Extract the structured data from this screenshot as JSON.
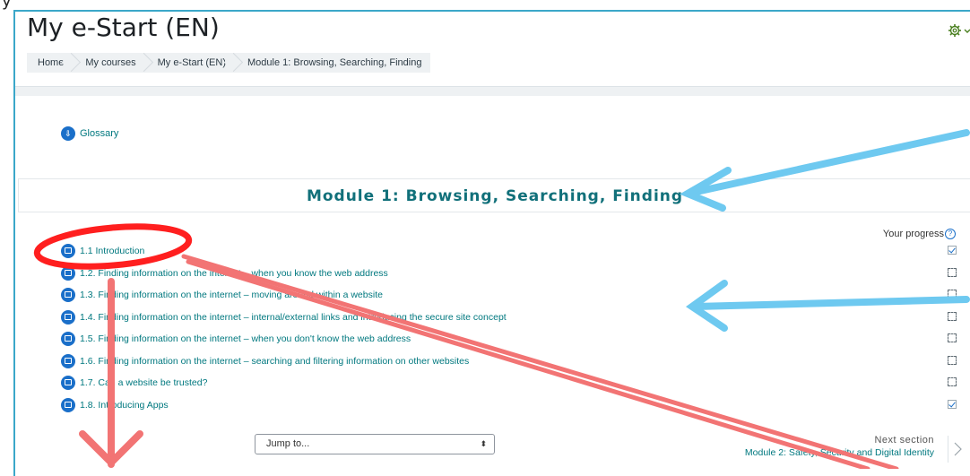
{
  "page": {
    "title": "My e-Start (EN)",
    "top_glyph": "y"
  },
  "breadcrumb": [
    "Home",
    "My courses",
    "My e-Start (EN)",
    "Module 1: Browsing, Searching, Finding"
  ],
  "glossary": {
    "label": "Glossary",
    "icon": "download-arrow-icon"
  },
  "section": {
    "title": "Module 1: Browsing, Searching, Finding"
  },
  "progress": {
    "label": "Your progress",
    "help_glyph": "?"
  },
  "activities": [
    {
      "label": "1.1 Introduction",
      "completed": true
    },
    {
      "label": "1.2. Finding information on the internet – when you know the web address",
      "completed": false
    },
    {
      "label": "1.3. Finding information on the internet – moving around within a website",
      "completed": false
    },
    {
      "label": "1.4. Finding information on the internet – internal/external links and introducing the secure site concept",
      "completed": false
    },
    {
      "label": "1.5. Finding information on the internet – when you don't know the web address",
      "completed": false
    },
    {
      "label": "1.6. Finding information on the internet – searching and filtering information on other websites",
      "completed": false
    },
    {
      "label": "1.7. Can a website be trusted?",
      "completed": false
    },
    {
      "label": "1.8. Introducing Apps",
      "completed": true
    }
  ],
  "jump": {
    "selected": "Jump to...",
    "caret": "⬍"
  },
  "next_section": {
    "caption": "Next section",
    "title": "Module 2: Safety, Security and Digital Identity"
  },
  "colors": {
    "link": "#00787f",
    "icon": "#1a6fc9",
    "annotation_blue": "#6ec9f0",
    "annotation_red": "#f27474"
  }
}
